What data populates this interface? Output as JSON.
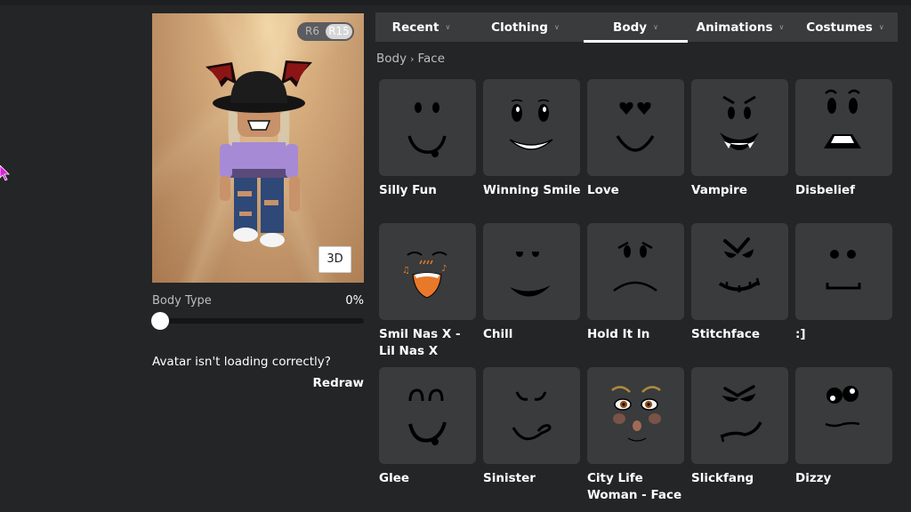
{
  "avatar": {
    "rig_options": [
      "R6",
      "R15"
    ],
    "rig_selected": "R15",
    "view_3d_label": "3D",
    "body_type_label": "Body Type",
    "body_type_value": "0%",
    "body_type_fraction": 0.0,
    "warning_text": "Avatar isn't loading correctly?",
    "redraw_label": "Redraw"
  },
  "tabs": [
    {
      "label": "Recent",
      "active": false
    },
    {
      "label": "Clothing",
      "active": false
    },
    {
      "label": "Body",
      "active": true
    },
    {
      "label": "Animations",
      "active": false
    },
    {
      "label": "Costumes",
      "active": false
    }
  ],
  "breadcrumb": {
    "parent": "Body",
    "separator": "›",
    "current": "Face"
  },
  "items": [
    {
      "name": "Silly Fun",
      "icon": "silly-fun-face-icon"
    },
    {
      "name": "Winning Smile",
      "icon": "winning-smile-face-icon"
    },
    {
      "name": "Love",
      "icon": "love-face-icon"
    },
    {
      "name": "Vampire",
      "icon": "vampire-face-icon"
    },
    {
      "name": "Disbelief",
      "icon": "disbelief-face-icon"
    },
    {
      "name": "Smil Nas X - Lil Nas X",
      "icon": "smil-nas-x-face-icon"
    },
    {
      "name": "Chill",
      "icon": "chill-face-icon"
    },
    {
      "name": "Hold It In",
      "icon": "hold-it-in-face-icon"
    },
    {
      "name": "Stitchface",
      "icon": "stitchface-face-icon"
    },
    {
      "name": ":]",
      "icon": "bracket-smile-face-icon"
    },
    {
      "name": "Glee",
      "icon": "glee-face-icon"
    },
    {
      "name": "Sinister",
      "icon": "sinister-face-icon"
    },
    {
      "name": "City Life Woman - Face",
      "icon": "city-life-woman-face-icon"
    },
    {
      "name": "Slickfang",
      "icon": "slickfang-face-icon"
    },
    {
      "name": "Dizzy",
      "icon": "dizzy-face-icon"
    }
  ],
  "colors": {
    "background": "#232527",
    "tile": "#393b3d",
    "accent_music": "#e8782a"
  }
}
